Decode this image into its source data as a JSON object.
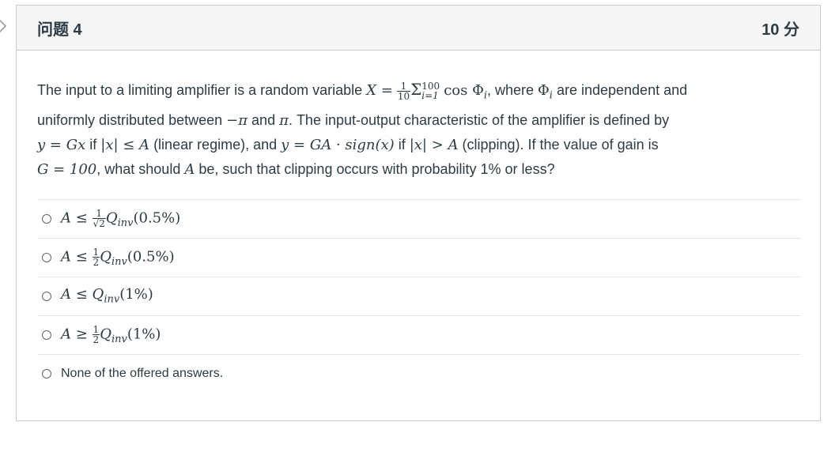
{
  "question": {
    "title": "问题 4",
    "points": "10 分",
    "text": {
      "p1_a": "The input to a limiting amplifier is a random variable ",
      "p1_b": ", where ",
      "p1_c": " are independent and",
      "p2_a": "uniformly distributed between ",
      "p2_b": " and ",
      "p2_c": ". The input-output characteristic of the amplifier is defined by",
      "p3_a": " if ",
      "p3_b": " (linear regime), and ",
      "p3_c": " if ",
      "p3_d": " (clipping). If the value of gain is",
      "p4_a": ", what should ",
      "p4_b": " be, such that clipping occurs with probability 1% or less?"
    },
    "math": {
      "X_eq": "X =",
      "frac1_num": "1",
      "frac1_den": "10",
      "sum": "Σ",
      "sum_top": "100",
      "sum_bot": "i=1",
      "cos_phi": "cos Φ",
      "sub_i": "i",
      "phi_i": "Φ",
      "minus_pi": "−π",
      "pi": "π",
      "y_eq_gx": "y = Gx",
      "abs_x_le_A": "|x| ≤ A",
      "y_eq_ga": "y = GA · sign(x)",
      "abs_x_gt_A": "|x| > A",
      "G_eq": "G = 100",
      "A": "A"
    }
  },
  "answers": [
    {
      "lhs": "A ≤",
      "frac_num": "1",
      "frac_den": "√2",
      "rhs": "Q",
      "sub": "inv",
      "arg": "(0.5%)"
    },
    {
      "lhs": "A ≤",
      "frac_num": "1",
      "frac_den": "2",
      "rhs": "Q",
      "sub": "inv",
      "arg": "(0.5%)"
    },
    {
      "lhs": "A ≤",
      "frac_num": "",
      "frac_den": "",
      "rhs": "Q",
      "sub": "inv",
      "arg": "(1%)"
    },
    {
      "lhs": "A ≥",
      "frac_num": "1",
      "frac_den": "2",
      "rhs": "Q",
      "sub": "inv",
      "arg": "(1%)"
    },
    {
      "text": "None of the offered answers."
    }
  ]
}
